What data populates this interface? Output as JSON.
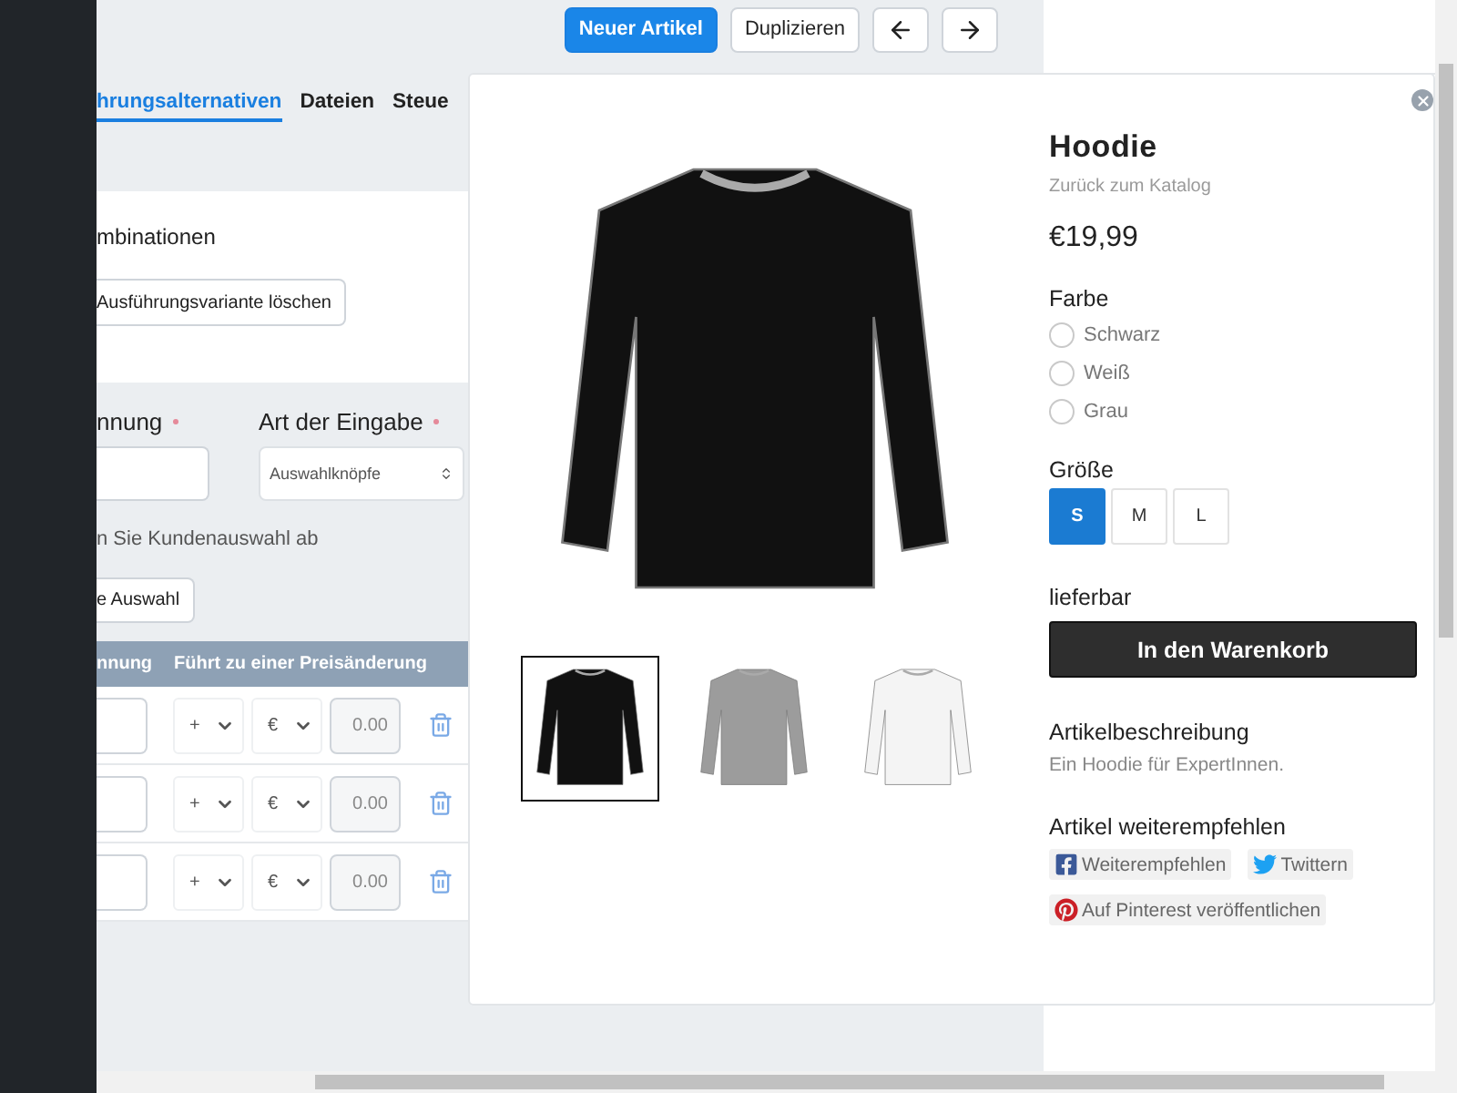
{
  "toolbar": {
    "buttons": [
      {
        "kind": "primary",
        "label": "Neuer Artikel"
      },
      {
        "kind": "default",
        "label": "Duplizieren"
      },
      {
        "kind": "prev"
      },
      {
        "kind": "next"
      }
    ]
  },
  "tabs": [
    {
      "label": "hrungsalternativen",
      "selected": true
    },
    {
      "label": "Dateien",
      "selected": false
    },
    {
      "label": "Steue",
      "selected": false
    }
  ],
  "combinations": {
    "heading": "mbinationen",
    "delete_button": "Ausführungsvariante löschen"
  },
  "option_form": {
    "name_label": "nnung",
    "name_required": true,
    "type_label": "Art der Eingabe",
    "type_required": true,
    "type_value": "Auswahlknöpfe",
    "hint": "n Sie Kundenauswahl ab",
    "button": "e Auswahl"
  },
  "options_table": {
    "columns": [
      "nnung",
      "Führt zu einer Preisänderung"
    ],
    "rows": [
      {
        "sign": "+",
        "currency": "€",
        "amount_placeholder": "0.00"
      },
      {
        "sign": "+",
        "currency": "€",
        "amount_placeholder": "0.00"
      },
      {
        "sign": "+",
        "currency": "€",
        "amount_placeholder": "0.00"
      }
    ]
  },
  "product": {
    "title": "Hoodie",
    "back_link": "Zurück zum Katalog",
    "price": "€19,99",
    "thumbnails": [
      {
        "color": "#111111",
        "selected": true
      },
      {
        "color": "#9c9c9c",
        "selected": false
      },
      {
        "color": "#f4f4f4",
        "selected": false
      }
    ],
    "color_label": "Farbe",
    "colors": [
      {
        "label": "Schwarz",
        "selected": false
      },
      {
        "label": "Weiß",
        "selected": false
      },
      {
        "label": "Grau",
        "selected": false
      }
    ],
    "size_label": "Größe",
    "sizes": [
      {
        "label": "S",
        "selected": true
      },
      {
        "label": "M",
        "selected": false
      },
      {
        "label": "L",
        "selected": false
      }
    ],
    "availability": "lieferbar",
    "cart_button": "In den Warenkorb",
    "description_heading": "Artikelbeschreibung",
    "description": "Ein Hoodie für ExpertInnen.",
    "share_heading": "Artikel weiterempfehlen",
    "share": [
      {
        "kind": "facebook",
        "label": "Weiterempfehlen"
      },
      {
        "kind": "twitter",
        "label": "Twittern"
      },
      {
        "kind": "pinterest",
        "label": "Auf Pinterest veröffentlichen"
      }
    ]
  }
}
